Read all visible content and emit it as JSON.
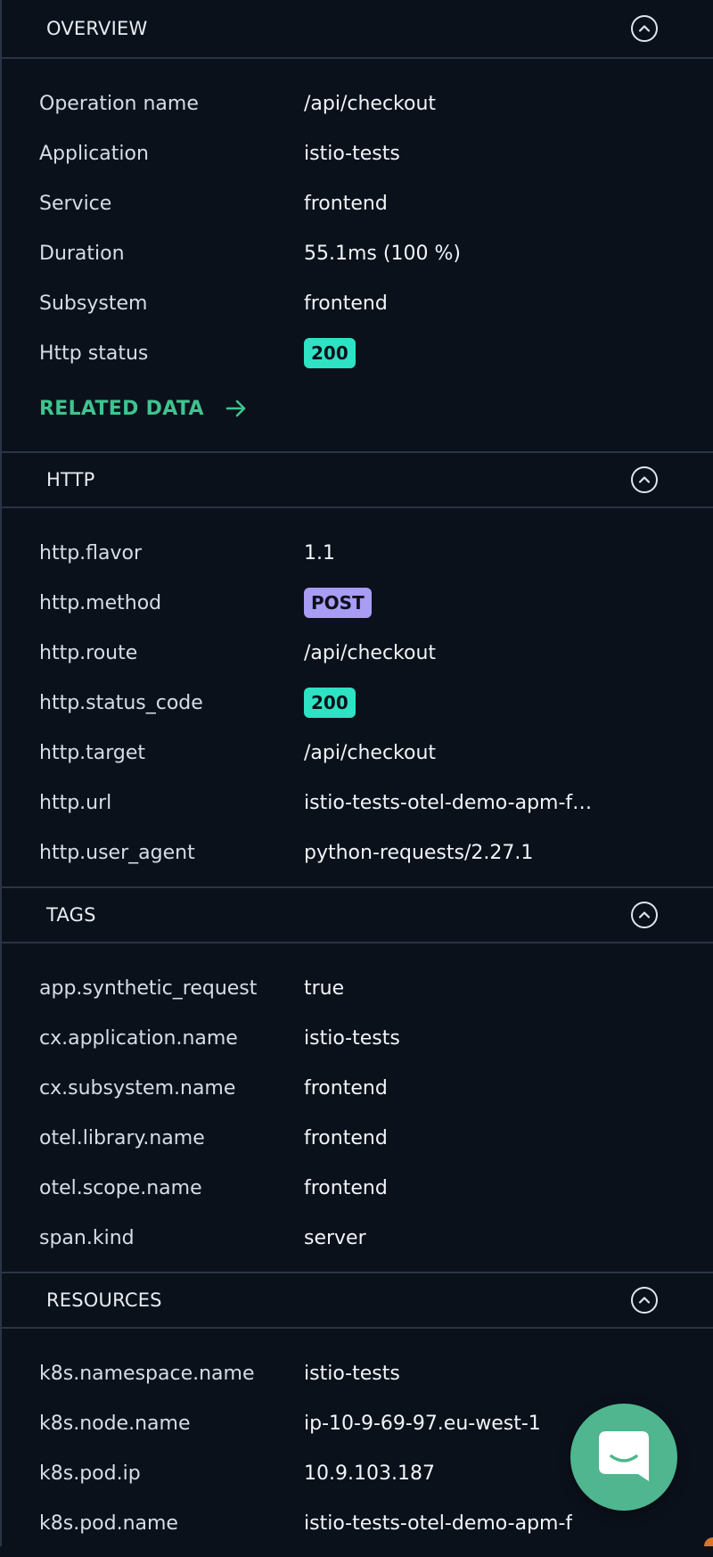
{
  "sections": {
    "overview": {
      "title": "OVERVIEW",
      "rows": [
        {
          "key": "Operation name",
          "value": "/api/checkout"
        },
        {
          "key": "Application",
          "value": "istio-tests"
        },
        {
          "key": "Service",
          "value": "frontend"
        },
        {
          "key": "Duration",
          "value": "55.1ms (100 %)"
        },
        {
          "key": "Subsystem",
          "value": "frontend"
        },
        {
          "key": "Http status",
          "value": "200"
        }
      ],
      "related_label": "RELATED DATA"
    },
    "http": {
      "title": "HTTP",
      "rows": [
        {
          "key": "http.flavor",
          "value": "1.1"
        },
        {
          "key": "http.method",
          "value": "POST"
        },
        {
          "key": "http.route",
          "value": "/api/checkout"
        },
        {
          "key": "http.status_code",
          "value": "200"
        },
        {
          "key": "http.target",
          "value": "/api/checkout"
        },
        {
          "key": "http.url",
          "value": "istio-tests-otel-demo-apm-f…"
        },
        {
          "key": "http.user_agent",
          "value": "python-requests/2.27.1"
        }
      ]
    },
    "tags": {
      "title": "TAGS",
      "rows": [
        {
          "key": "app.synthetic_request",
          "value": "true"
        },
        {
          "key": "cx.application.name",
          "value": "istio-tests"
        },
        {
          "key": "cx.subsystem.name",
          "value": "frontend"
        },
        {
          "key": "otel.library.name",
          "value": "frontend"
        },
        {
          "key": "otel.scope.name",
          "value": "frontend"
        },
        {
          "key": "span.kind",
          "value": "server"
        }
      ]
    },
    "resources": {
      "title": "RESOURCES",
      "rows": [
        {
          "key": "k8s.namespace.name",
          "value": "istio-tests"
        },
        {
          "key": "k8s.node.name",
          "value": "ip-10-9-69-97.eu-west-1"
        },
        {
          "key": "k8s.pod.ip",
          "value": "10.9.103.187"
        },
        {
          "key": "k8s.pod.name",
          "value": "istio-tests-otel-demo-apm-f"
        }
      ]
    }
  },
  "icons": {
    "collapse": "chevron-up-circle-icon",
    "related_arrow": "arrow-right-icon",
    "chat": "chat-bubble-icon"
  },
  "colors": {
    "background": "#0b111b",
    "divider": "#2a3444",
    "status_200": "#2de3c3",
    "method_post": "#a89cf4",
    "related_link": "#3fc48f",
    "chat_button": "#4fb68f"
  }
}
